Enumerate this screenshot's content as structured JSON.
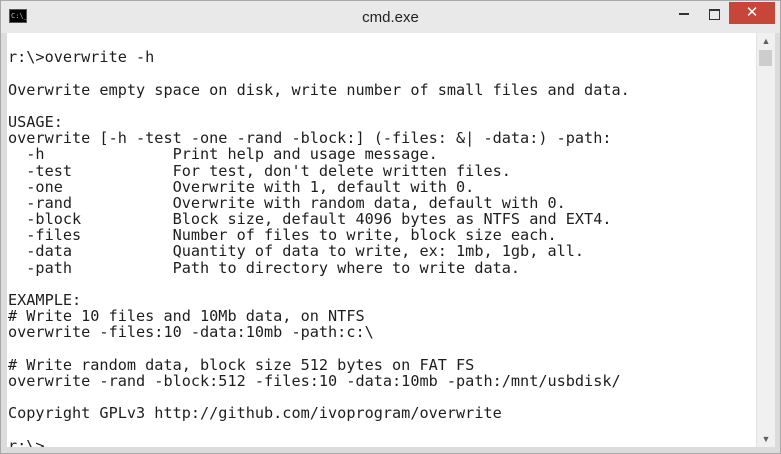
{
  "window": {
    "title": "cmd.exe",
    "icon": "cmd-icon",
    "icon_text": "C:\\_",
    "controls": {
      "minimize": "minimize-icon",
      "maximize": "maximize-icon",
      "close": "✕"
    }
  },
  "console": {
    "lines": [
      "",
      "r:\\>overwrite -h",
      "",
      "Overwrite empty space on disk, write number of small files and data.",
      "",
      "USAGE:",
      "overwrite [-h -test -one -rand -block:] (-files: &| -data:) -path:",
      "  -h              Print help and usage message.",
      "  -test           For test, don't delete written files.",
      "  -one            Overwrite with 1, default with 0.",
      "  -rand           Overwrite with random data, default with 0.",
      "  -block          Block size, default 4096 bytes as NTFS and EXT4.",
      "  -files          Number of files to write, block size each.",
      "  -data           Quantity of data to write, ex: 1mb, 1gb, all.",
      "  -path           Path to directory where to write data.",
      "",
      "EXAMPLE:",
      "# Write 10 files and 10Mb data, on NTFS",
      "overwrite -files:10 -data:10mb -path:c:\\",
      "",
      "# Write random data, block size 512 bytes on FAT FS",
      "overwrite -rand -block:512 -files:10 -data:10mb -path:/mnt/usbdisk/",
      "",
      "Copyright GPLv3 http://github.com/ivoprogram/overwrite",
      ""
    ],
    "prompt": "r:\\>"
  },
  "scrollbar": {
    "up": "▲",
    "down": "▼"
  },
  "colors": {
    "close_button": "#c7463a",
    "console_background": "#ffffff",
    "console_text": "#1e1e1e"
  }
}
